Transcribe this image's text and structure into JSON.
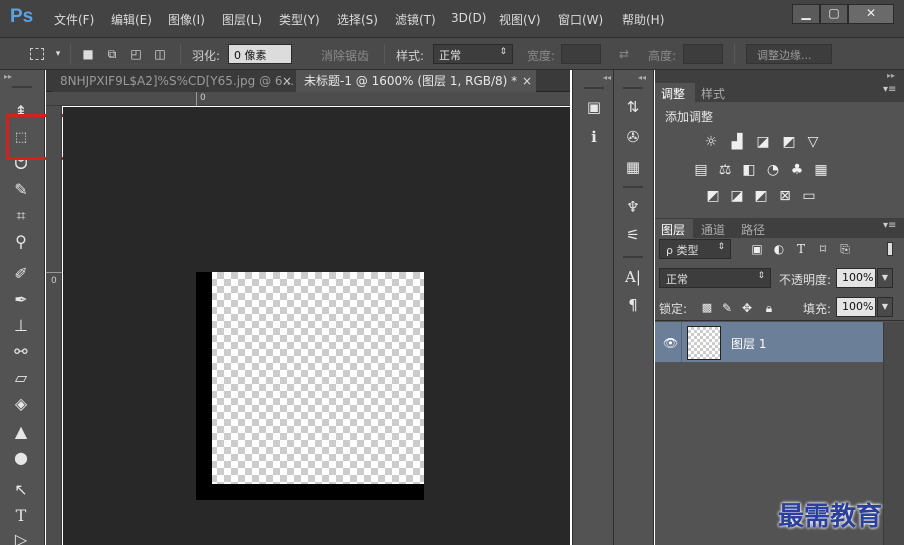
{
  "app": {
    "logo": "Ps"
  },
  "menu": [
    "文件(F)",
    "编辑(E)",
    "图像(I)",
    "图层(L)",
    "类型(Y)",
    "选择(S)",
    "滤镜(T)",
    "3D(D)",
    "视图(V)",
    "窗口(W)",
    "帮助(H)"
  ],
  "window_controls": {
    "minimize": "▁",
    "restore": "▢",
    "close": "✕"
  },
  "options": {
    "feather_label": "羽化:",
    "feather_value": "0 像素",
    "antialias_label": "消除锯齿",
    "style_label": "样式:",
    "style_value": "正常",
    "width_label": "宽度:",
    "height_label": "高度:",
    "refine_edge": "调整边缘..."
  },
  "documents": {
    "tab1": "8NHJPXIF9L$A2]%S%CD[Y65.jpg @ 6...",
    "tab2": "未标题-1 @ 1600% (图层 1, RGB/8) *",
    "close_glyph": "×"
  },
  "rulers": {
    "top_zero": "0",
    "left_zero": "0"
  },
  "adjustments": {
    "tab_adjust": "调整",
    "tab_style": "样式",
    "add_adjustment": "添加调整"
  },
  "layers_panel": {
    "tab_layers": "图层",
    "tab_channels": "通道",
    "tab_paths": "路径",
    "filter_kind": "ρ 类型",
    "blend_mode": "正常",
    "opacity_label": "不透明度:",
    "opacity_value": "100%",
    "lock_label": "锁定:",
    "fill_label": "填充:",
    "fill_value": "100%",
    "layers": [
      {
        "name": "图层 1"
      }
    ]
  },
  "watermark": "最需教育",
  "icons": {
    "tools": [
      "move-icon",
      "rect-marquee-icon",
      "lasso-icon",
      "quick-select-icon",
      "crop-icon",
      "eyedropper-icon",
      "healing-brush-icon",
      "brush-icon",
      "clone-stamp-icon",
      "history-brush-icon",
      "eraser-icon",
      "paint-bucket-icon",
      "blur-icon",
      "dodge-icon",
      "path-select-icon",
      "type-icon",
      "pen-icon"
    ]
  },
  "colors": {
    "highlight": "#d62020",
    "layer_selected": "#6b7f99"
  }
}
